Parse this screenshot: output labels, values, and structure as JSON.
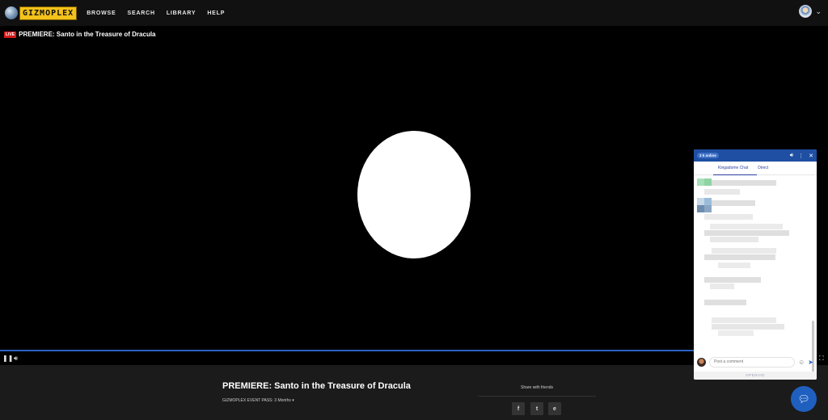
{
  "nav": {
    "logo_text": "GIZMOPLEX",
    "items": [
      "BROWSE",
      "SEARCH",
      "LIBRARY",
      "HELP"
    ]
  },
  "video": {
    "live_badge": "LIVE",
    "title": "PREMIERE: Santo in the Treasure of Dracula"
  },
  "info": {
    "title": "PREMIERE: Santo in the Treasure of Dracula",
    "pass": "GIZMOPLEX EVENT PASS: 3 Months",
    "share_title": "Share with friends",
    "share_buttons": [
      "f",
      "t",
      "e"
    ]
  },
  "chat": {
    "online_badge": "3 k online",
    "tabs": [
      "Kingadome Chat",
      "Direct"
    ],
    "composer_placeholder": "Post a comment",
    "footer": "OPENVID"
  },
  "icons": {
    "pause": "pause-icon",
    "volume": "volume-icon",
    "fullscreen": "fullscreen-icon",
    "chat_bubble": "chat-bubble-icon"
  },
  "colors": {
    "accent": "#1e4fa3",
    "live": "#d71a1a",
    "logo": "#f4c21a"
  }
}
